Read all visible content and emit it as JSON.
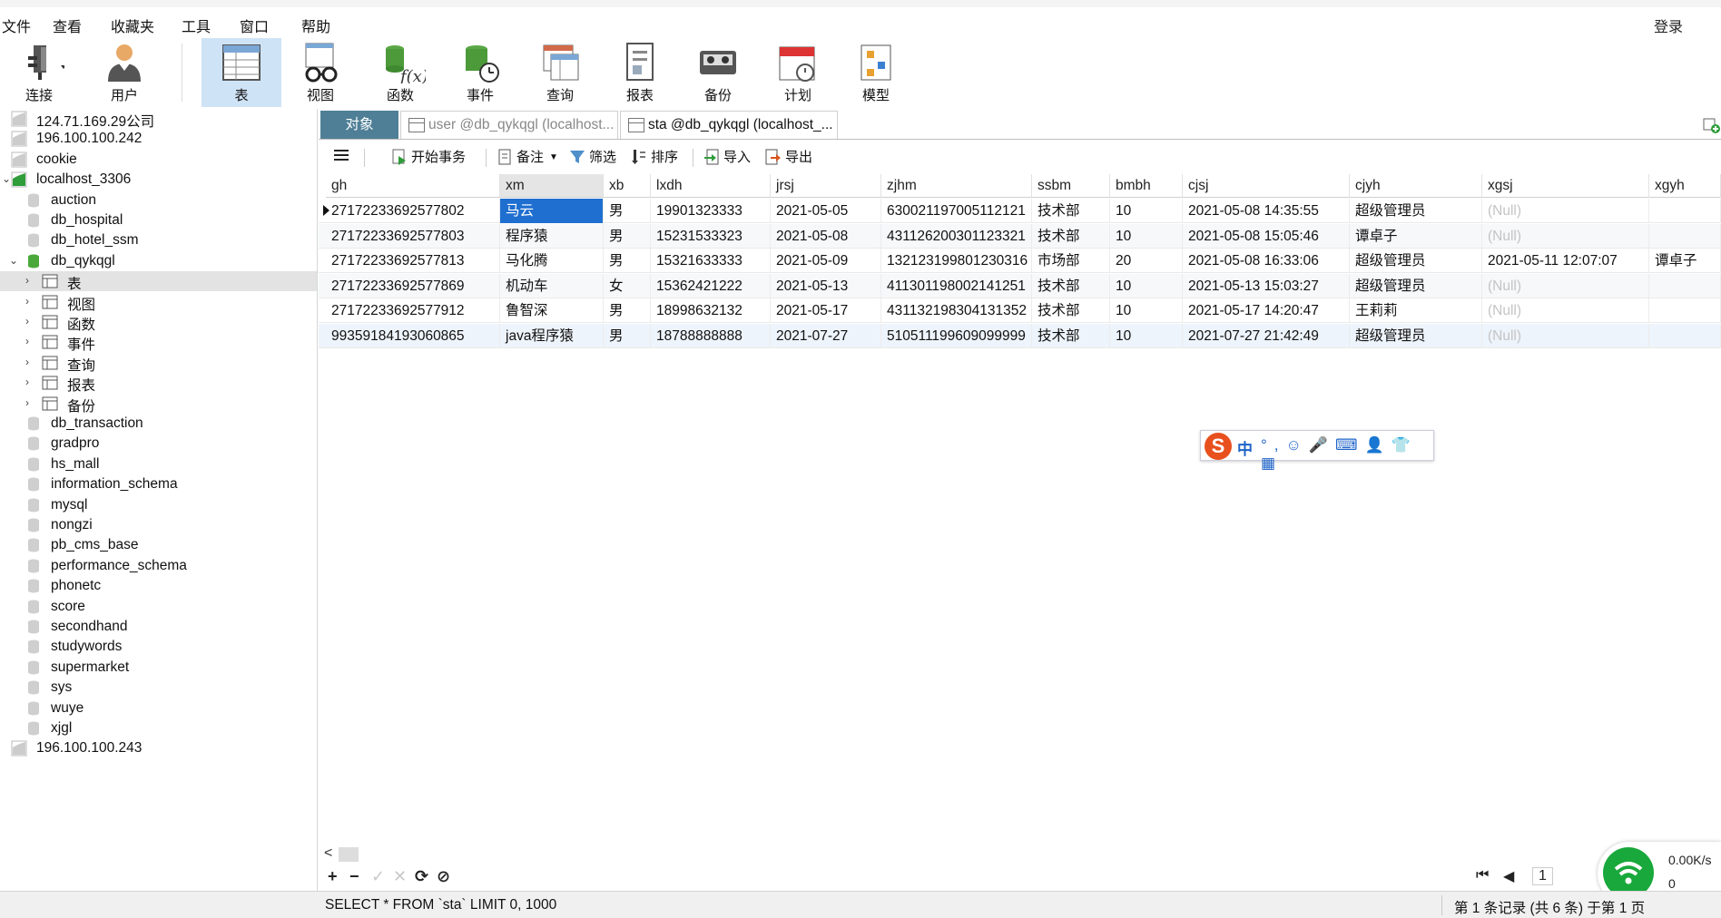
{
  "menu": [
    "文件",
    "查看",
    "收藏夹",
    "工具",
    "窗口",
    "帮助"
  ],
  "login_label": "登录",
  "toolbar": {
    "connect": "连接",
    "user": "用户",
    "table": "表",
    "view": "视图",
    "function": "函数",
    "event": "事件",
    "query": "查询",
    "report": "报表",
    "backup": "备份",
    "schedule": "计划",
    "model": "模型"
  },
  "sidebar": {
    "items": [
      {
        "label": "124.71.169.29公司",
        "level": 0
      },
      {
        "label": "196.100.100.242",
        "level": 0
      },
      {
        "label": "cookie",
        "level": 0
      },
      {
        "label": "localhost_3306",
        "level": 0,
        "expanded": true
      },
      {
        "label": "auction",
        "level": 1
      },
      {
        "label": "db_hospital",
        "level": 1
      },
      {
        "label": "db_hotel_ssm",
        "level": 1
      },
      {
        "label": "db_qykqgl",
        "level": 1,
        "expanded": true
      },
      {
        "label": "表",
        "level": 2,
        "selected": true
      },
      {
        "label": "视图",
        "level": 2
      },
      {
        "label": "函数",
        "level": 2
      },
      {
        "label": "事件",
        "level": 2
      },
      {
        "label": "查询",
        "level": 2
      },
      {
        "label": "报表",
        "level": 2
      },
      {
        "label": "备份",
        "level": 2
      },
      {
        "label": "db_transaction",
        "level": 1
      },
      {
        "label": "gradpro",
        "level": 1
      },
      {
        "label": "hs_mall",
        "level": 1
      },
      {
        "label": "information_schema",
        "level": 1
      },
      {
        "label": "mysql",
        "level": 1
      },
      {
        "label": "nongzi",
        "level": 1
      },
      {
        "label": "pb_cms_base",
        "level": 1
      },
      {
        "label": "performance_schema",
        "level": 1
      },
      {
        "label": "phonetc",
        "level": 1
      },
      {
        "label": "score",
        "level": 1
      },
      {
        "label": "secondhand",
        "level": 1
      },
      {
        "label": "studywords",
        "level": 1
      },
      {
        "label": "supermarket",
        "level": 1
      },
      {
        "label": "sys",
        "level": 1
      },
      {
        "label": "wuye",
        "level": 1
      },
      {
        "label": "xjgl",
        "level": 1
      },
      {
        "label": "196.100.100.243",
        "level": 0
      }
    ]
  },
  "tabs": {
    "objects": "对象",
    "doc1": "user @db_qykqgl (localhost...",
    "doc2": "sta @db_qykqgl (localhost_..."
  },
  "subtoolbar": {
    "begin_tx": "开始事务",
    "memo": "备注",
    "filter": "筛选",
    "sort": "排序",
    "import": "导入",
    "export": "导出"
  },
  "grid": {
    "columns": [
      "gh",
      "xm",
      "xb",
      "lxdh",
      "jrsj",
      "zjhm",
      "ssbm",
      "bmbh",
      "cjsj",
      "cjyh",
      "xgsj",
      "xgyh"
    ],
    "rows": [
      [
        "27172233692577802",
        "马云",
        "男",
        "19901323333",
        "2021-05-05",
        "630021197005112121",
        "技术部",
        "10",
        "2021-05-08 14:35:55",
        "超级管理员",
        "(Null)",
        ""
      ],
      [
        "27172233692577803",
        "程序猿",
        "男",
        "15231533323",
        "2021-05-08",
        "431126200301123321",
        "技术部",
        "10",
        "2021-05-08 15:05:46",
        "谭卓子",
        "(Null)",
        ""
      ],
      [
        "27172233692577813",
        "马化腾",
        "男",
        "15321633333",
        "2021-05-09",
        "132123199801230316",
        "市场部",
        "20",
        "2021-05-08 16:33:06",
        "超级管理员",
        "2021-05-11 12:07:07",
        "谭卓子"
      ],
      [
        "27172233692577869",
        "机动车",
        "女",
        "15362421222",
        "2021-05-13",
        "411301198002141251",
        "技术部",
        "10",
        "2021-05-13 15:03:27",
        "超级管理员",
        "(Null)",
        ""
      ],
      [
        "27172233692577912",
        "鲁智深",
        "男",
        "18998632132",
        "2021-05-17",
        "431132198304131352",
        "技术部",
        "10",
        "2021-05-17 14:20:47",
        "王莉莉",
        "(Null)",
        ""
      ],
      [
        "99359184193060865",
        "java程序猿",
        "男",
        "18788888888",
        "2021-07-27",
        "510511199609099999",
        "技术部",
        "10",
        "2021-07-27 21:42:49",
        "超级管理员",
        "(Null)",
        ""
      ]
    ]
  },
  "ime": {
    "logo": "S",
    "zh": "中",
    "icons": "°,☺🎤⌨👤👕▦"
  },
  "pager": {
    "page": "1"
  },
  "status": {
    "sql": "SELECT * FROM `sta` LIMIT 0, 1000",
    "records": "第 1 条记录 (共 6 条) 于第 1 页"
  },
  "network": {
    "speed": "0.00K/s",
    "count": "0"
  },
  "colors": {
    "selected_cell": "#1f6fd0",
    "object_tab": "#4f7f96",
    "active_tool": "#cfe3f6"
  }
}
